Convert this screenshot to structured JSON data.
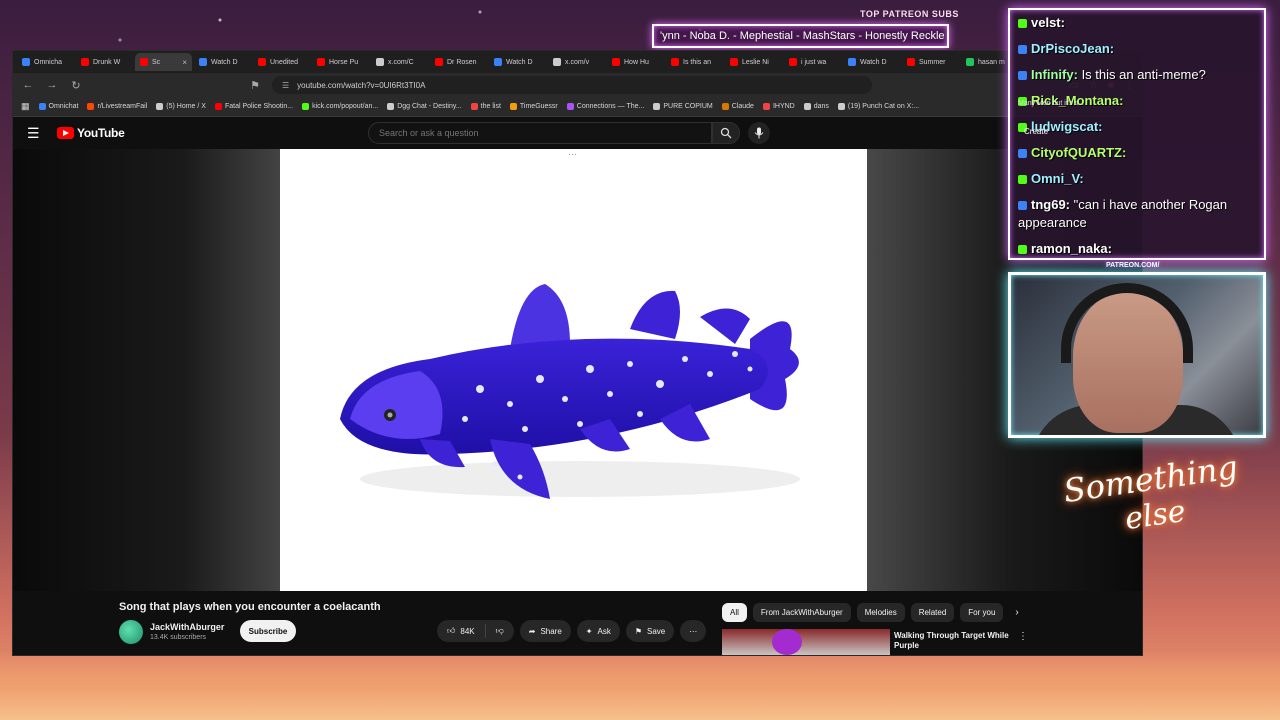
{
  "overlay": {
    "patreon_label": "TOP PATREON SUBS",
    "ticker_text": "'ynn -  Noba D. - Mephestial - MashStars - Honestly Reckle",
    "patreon_tag": "PATREON.COM/",
    "signature_line1": "Something",
    "signature_line2": "else",
    "accent_chat": "#d46cff",
    "accent_cam": "#67f0ff"
  },
  "browser": {
    "tabs": [
      {
        "label": "Omnicha",
        "color": "#3b82f6"
      },
      {
        "label": "Drunk W",
        "color": "#ff0000"
      },
      {
        "label": "Sc",
        "color": "#ff0000",
        "active": true
      },
      {
        "label": "Watch D",
        "color": "#3b82f6"
      },
      {
        "label": "Unedited",
        "color": "#ff0000"
      },
      {
        "label": "Horse Pu",
        "color": "#ff0000"
      },
      {
        "label": "x.com/C",
        "color": "#cccccc"
      },
      {
        "label": "Dr Rosen",
        "color": "#ff0000"
      },
      {
        "label": "Watch D",
        "color": "#3b82f6"
      },
      {
        "label": "x.com/v",
        "color": "#cccccc"
      },
      {
        "label": "How Hu",
        "color": "#ff0000"
      },
      {
        "label": "Is this an",
        "color": "#ff0000"
      },
      {
        "label": "Leslie Ni",
        "color": "#ff0000"
      },
      {
        "label": "i just wa",
        "color": "#ff0000"
      },
      {
        "label": "Watch D",
        "color": "#3b82f6"
      },
      {
        "label": "Summer",
        "color": "#ff0000"
      },
      {
        "label": "hasan m",
        "color": "#22c55e"
      }
    ],
    "url": "youtube.com/watch?v=0UI6Rt3TI0A",
    "bookmarks": [
      {
        "label": "Omnichat",
        "color": "#3b82f6"
      },
      {
        "label": "r/LivestreamFail",
        "color": "#ff4500"
      },
      {
        "label": "(5) Home / X",
        "color": "#cccccc"
      },
      {
        "label": "Fatal Police Shootin...",
        "color": "#ff0000"
      },
      {
        "label": "kick.com/popout/an...",
        "color": "#53fc18"
      },
      {
        "label": "Dgg Chat - Destiny...",
        "color": "#cccccc"
      },
      {
        "label": "the list",
        "color": "#ef4444"
      },
      {
        "label": "TimeGuessr",
        "color": "#f59e0b"
      },
      {
        "label": "Connections — The...",
        "color": "#a855f7"
      },
      {
        "label": "PURE COPIUM",
        "color": "#cccccc"
      },
      {
        "label": "Claude",
        "color": "#d97706"
      },
      {
        "label": "IHYND",
        "color": "#ef4444"
      },
      {
        "label": "dans",
        "color": "#cccccc"
      },
      {
        "label": "(19) Punch Cat on X:...",
        "color": "#cccccc"
      }
    ]
  },
  "youtube": {
    "logo_text": "YouTube",
    "search_placeholder": "Search or ask a question",
    "video_title": "Song that plays when you encounter a coelacanth",
    "channel_name": "JackWithAburger",
    "channel_subs": "13.4K subscribers",
    "subscribe_label": "Subscribe",
    "like_count": "84K",
    "share_label": "Share",
    "ask_label": "Ask",
    "save_label": "Save",
    "chips": [
      "All",
      "From JackWithAburger",
      "Melodies",
      "Related",
      "For you"
    ],
    "rec_title": "Walking Through Target While Purple",
    "brand_red": "#ff0000"
  },
  "chat": {
    "messages": [
      {
        "user": "velst:",
        "text": "",
        "color": "#ffffff",
        "badge": "#53fc18"
      },
      {
        "user": "DrPiscoJean:",
        "text": "",
        "color": "#9ef0ff",
        "badge": "#3b82f6"
      },
      {
        "user": "Infinify:",
        "text": "Is this an anti-meme?",
        "color": "#9eff9e",
        "badge": "#3b82f6"
      },
      {
        "user": "Rick_Montana:",
        "text": "",
        "color": "#b4ff6a",
        "badge": "#53fc18"
      },
      {
        "user": "ludwigscat:",
        "text": "",
        "color": "#9ef0ff",
        "badge": "#53fc18"
      },
      {
        "user": "CityofQUARTZ:",
        "text": "",
        "color": "#b4ff6a",
        "badge": "#3b82f6"
      },
      {
        "user": "Omni_V:",
        "text": "",
        "color": "#9ef0ff",
        "badge": "#53fc18"
      },
      {
        "user": "tng69:",
        "text": "\"can i have another Rogan appearance",
        "color": "#ffffff",
        "badge": "#3b82f6"
      },
      {
        "user": "ramon_naka:",
        "text": "",
        "color": "#ffffff",
        "badge": "#53fc18"
      }
    ],
    "tools_text": "Many Men but it's s...",
    "create_label": "Create"
  }
}
